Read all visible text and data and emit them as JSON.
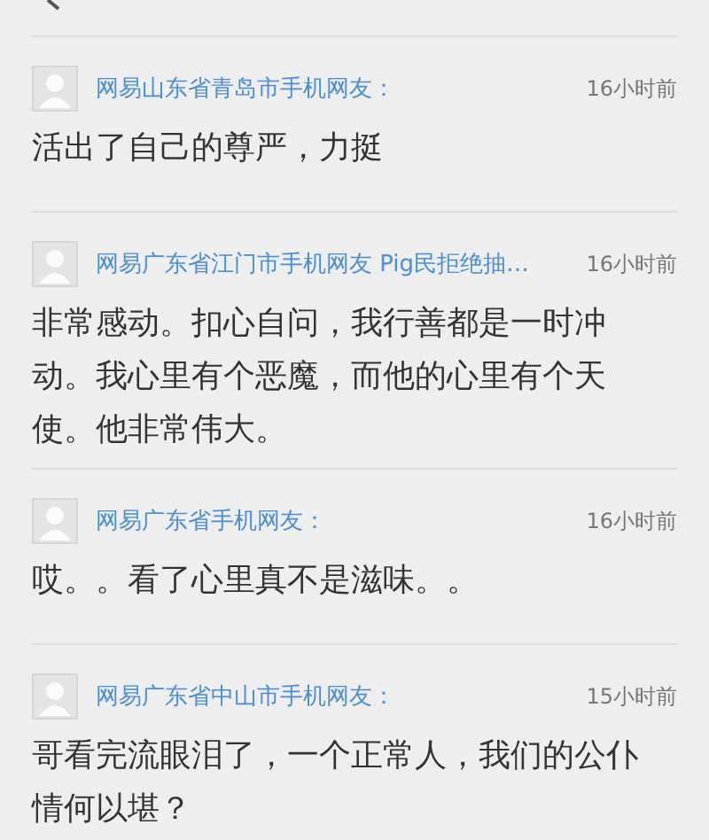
{
  "comments": [
    {
      "user": "网易山东省青岛市手机网友：",
      "time": "16小时前",
      "text": "活出了自己的尊严，力挺"
    },
    {
      "user": "网易广东省江门市手机网友 Pig民拒绝抽…",
      "time": "16小时前",
      "text": "非常感动。扣心自问，我行善都是一时冲动。我心里有个恶魔，而他的心里有个天使。他非常伟大。"
    },
    {
      "user": "网易广东省手机网友：",
      "time": "16小时前",
      "text": "哎。。看了心里真不是滋味。。"
    },
    {
      "user": "网易广东省中山市手机网友：",
      "time": "15小时前",
      "text": "哥看完流眼泪了，一个正常人，我们的公仆情何以堪？"
    }
  ]
}
